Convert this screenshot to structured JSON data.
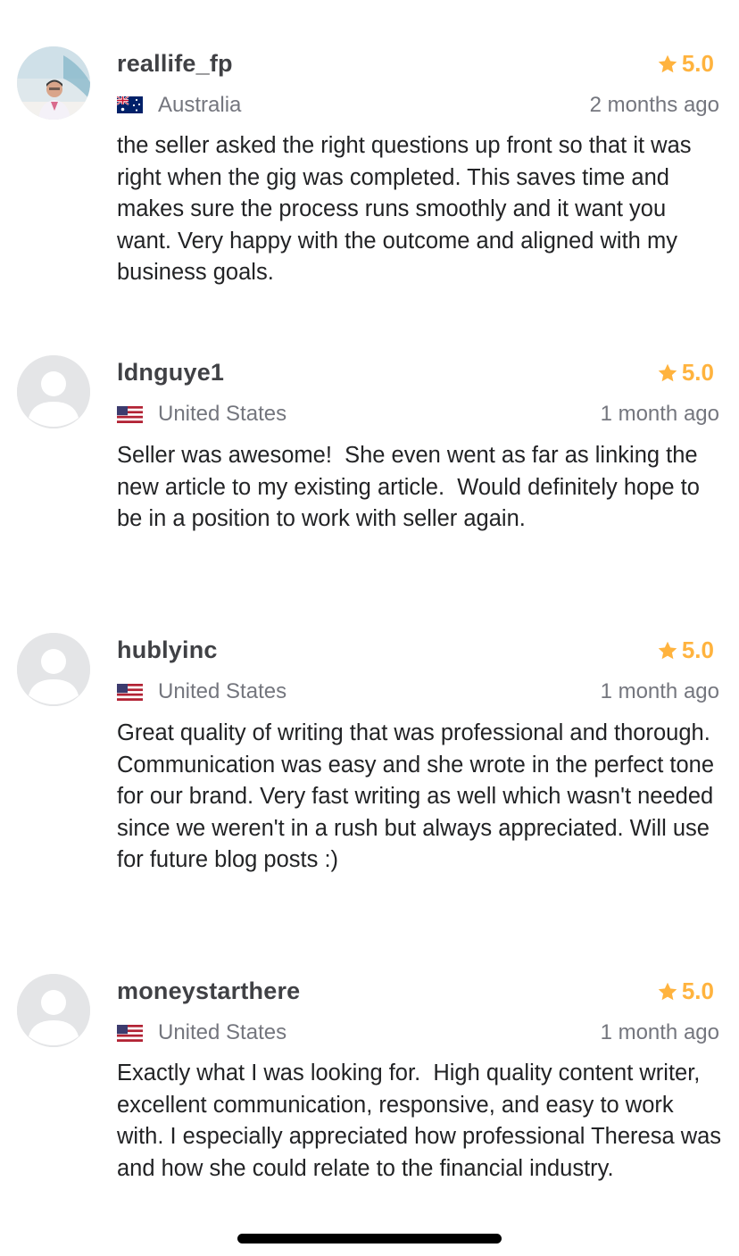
{
  "colors": {
    "star": "#ffb33e",
    "username": "#404145",
    "muted": "#74767e",
    "text": "#222325"
  },
  "reviews": [
    {
      "username": "reallife_fp",
      "rating": "5.0",
      "country": "Australia",
      "flag": "australia-flag-icon",
      "time": "2 months ago",
      "text": "the seller asked the right questions up front so that it was right when the gig was completed. This saves time and makes sure the process runs smoothly and it want you want. Very happy with the outcome and aligned with my business goals."
    },
    {
      "username": "ldnguye1",
      "rating": "5.0",
      "country": "United States",
      "flag": "us-flag-icon",
      "time": "1 month ago",
      "text": "Seller was awesome!  She even went as far as linking the new article to my existing article.  Would definitely hope to be in a position to work with seller again."
    },
    {
      "username": "hublyinc",
      "rating": "5.0",
      "country": "United States",
      "flag": "us-flag-icon",
      "time": "1 month ago",
      "text": "Great quality of writing that was professional and thorough. Communication was easy and she wrote in the perfect tone for our brand. Very fast writing as well which wasn't needed since we weren't in a rush but always appreciated. Will use for future blog posts :)"
    },
    {
      "username": "moneystarthere",
      "rating": "5.0",
      "country": "United States",
      "flag": "us-flag-icon",
      "time": "1 month ago",
      "text": "Exactly what I was looking for.  High quality content writer, excellent communication, responsive, and easy to work with. I especially appreciated how professional Theresa was and how she could relate to the financial industry."
    }
  ]
}
